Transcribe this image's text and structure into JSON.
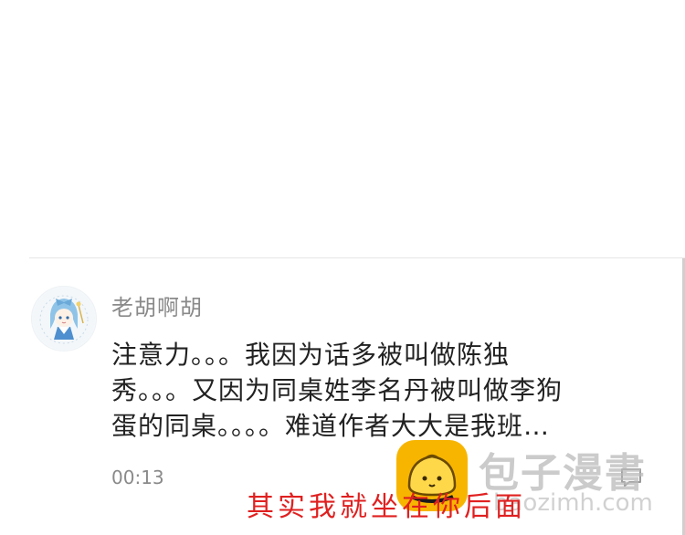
{
  "comment": {
    "username": "老胡啊胡",
    "body_lines": [
      "注意力。。。我因为话多被叫做陈独",
      "秀。。。又因为同桌姓李名丹被叫做李狗",
      "蛋的同桌。。。。难道作者大大是我班…"
    ],
    "timestamp": "00:13",
    "avatar_icon": "anime-girl-avatar",
    "reply_icon": "comment-reply-icon"
  },
  "caption": {
    "text": "其实我就坐在你后面",
    "color": "#e02020"
  },
  "watermark": {
    "brand": "包子漫書",
    "url": "baozimh.com",
    "logo_icon": "bun-logo-icon",
    "logo_color": "#f7b500"
  }
}
